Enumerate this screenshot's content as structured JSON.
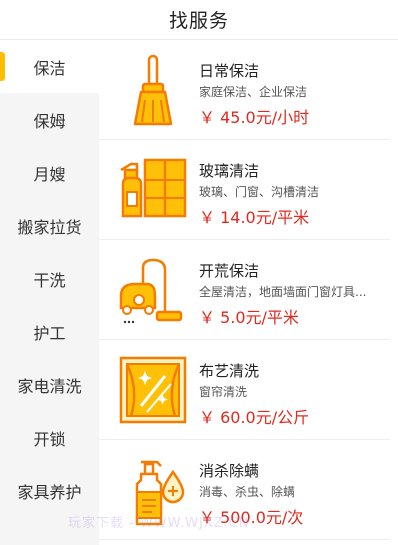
{
  "header": {
    "title": "找服务"
  },
  "sidebar": {
    "items": [
      {
        "label": "保洁",
        "active": true
      },
      {
        "label": "保姆"
      },
      {
        "label": "月嫂"
      },
      {
        "label": "搬家拉货"
      },
      {
        "label": "干洗"
      },
      {
        "label": "护工"
      },
      {
        "label": "家电清洗"
      },
      {
        "label": "开锁"
      },
      {
        "label": "家具养护"
      }
    ]
  },
  "services": [
    {
      "name": "日常保洁",
      "desc": "家庭保洁、企业保洁",
      "price": "￥ 45.0元/小时",
      "icon": "broom-icon"
    },
    {
      "name": "玻璃清洁",
      "desc": "玻璃、门窗、沟槽清洁",
      "price": "￥ 14.0元/平米",
      "icon": "spray-window-icon"
    },
    {
      "name": "开荒保洁",
      "desc": "全屋清洁，地面墙面门窗灯具...",
      "price": "￥ 5.0元/平米",
      "icon": "vacuum-icon"
    },
    {
      "name": "布艺清洗",
      "desc": "窗帘清洗",
      "price": "￥ 60.0元/公斤",
      "icon": "curtain-icon"
    },
    {
      "name": "消杀除螨",
      "desc": "消毒、杀虫、除螨",
      "price": "￥ 500.0元/次",
      "icon": "disinfectant-icon"
    }
  ],
  "watermark": "玩家下载 - WWW.WJXZ.CN",
  "colors": {
    "accent": "#ffbf00",
    "price": "#e02a1f",
    "icon_orange": "#f57c00",
    "icon_yellow": "#ffc107"
  }
}
